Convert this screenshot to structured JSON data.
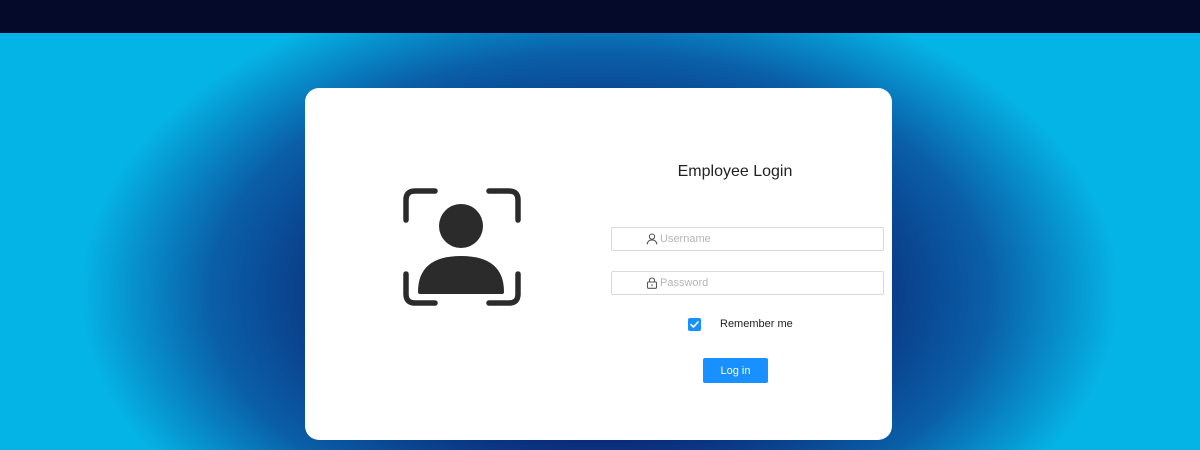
{
  "login": {
    "title": "Employee Login",
    "username": {
      "placeholder": "Username",
      "value": "",
      "icon": "user-icon"
    },
    "password": {
      "placeholder": "Password",
      "value": "",
      "icon": "lock-icon"
    },
    "remember": {
      "label": "Remember me",
      "checked": true
    },
    "submit_label": "Log in"
  },
  "illustration": {
    "icon": "face-scan-user-icon"
  },
  "colors": {
    "accent": "#1890ff",
    "card": "#ffffff",
    "topbar": "#050a2b",
    "backdrop_center": "#0b1f66",
    "backdrop_edge": "#05b4e6",
    "icon": "#2b2b2b"
  }
}
